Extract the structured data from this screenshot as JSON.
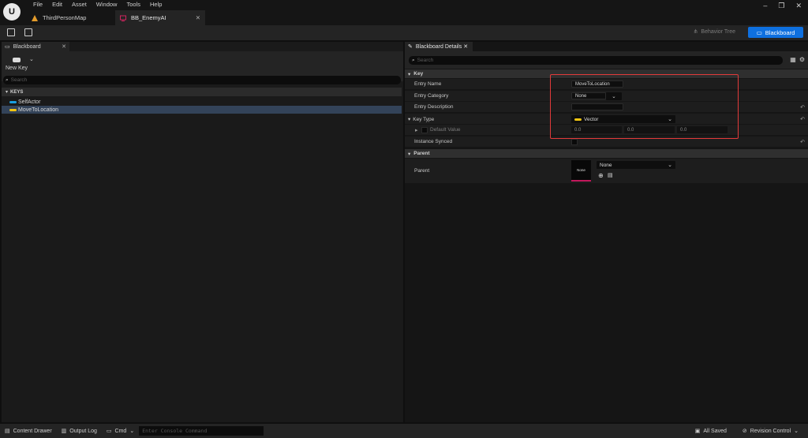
{
  "menu": [
    "File",
    "Edit",
    "Asset",
    "Window",
    "Tools",
    "Help"
  ],
  "tabs": [
    {
      "label": "ThirdPersonMap"
    },
    {
      "label": "BB_EnemyAI"
    }
  ],
  "toolbar": {
    "behavior_tree_label": "Behavior Tree",
    "blackboard_label": "Blackboard"
  },
  "blackboard": {
    "panel_title": "Blackboard",
    "new_key_label": "New Key",
    "search_placeholder": "Search",
    "keys_header": "KEYS",
    "keys": [
      {
        "label": "SelfActor",
        "color": "#1a9ee0"
      },
      {
        "label": "MoveToLocation",
        "color": "#f2c511"
      }
    ]
  },
  "details": {
    "panel_title": "Blackboard Details",
    "search_placeholder": "Search",
    "key_section": "Key",
    "entry_name_label": "Entry Name",
    "entry_name_value": "MoveToLocation",
    "entry_category_label": "Entry Category",
    "entry_category_value": "None",
    "entry_description_label": "Entry Description",
    "entry_description_value": "",
    "key_type_label": "Key Type",
    "key_type_value": "Vector",
    "default_value_label": "Default Value",
    "default_x": "0.0",
    "default_y": "0.0",
    "default_z": "0.0",
    "instance_synced_label": "Instance Synced",
    "parent_section": "Parent",
    "parent_label": "Parent",
    "parent_thumb_text": "None",
    "parent_value": "None"
  },
  "statusbar": {
    "content_drawer": "Content Drawer",
    "output_log": "Output Log",
    "cmd": "Cmd",
    "console_placeholder": "Enter Console Command",
    "all_saved": "All Saved",
    "revision_control": "Revision Control"
  },
  "colors": {
    "accent": "#0e70e0",
    "highlight_box": "#e23a3a",
    "vector_pin": "#f2c511",
    "selected_row": "#334359"
  }
}
